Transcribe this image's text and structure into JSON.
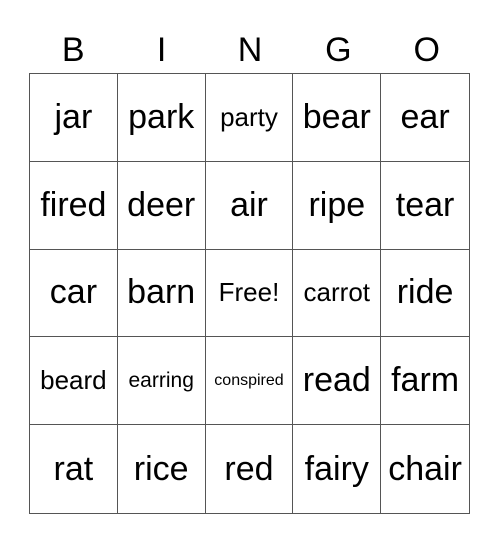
{
  "header": [
    "B",
    "I",
    "N",
    "G",
    "O"
  ],
  "rows": [
    [
      {
        "t": "jar"
      },
      {
        "t": "park"
      },
      {
        "t": "party",
        "s": "s-md"
      },
      {
        "t": "bear"
      },
      {
        "t": "ear"
      }
    ],
    [
      {
        "t": "fired"
      },
      {
        "t": "deer"
      },
      {
        "t": "air"
      },
      {
        "t": "ripe"
      },
      {
        "t": "tear"
      }
    ],
    [
      {
        "t": "car"
      },
      {
        "t": "barn"
      },
      {
        "t": "Free!",
        "s": "s-md"
      },
      {
        "t": "carrot",
        "s": "s-md"
      },
      {
        "t": "ride"
      }
    ],
    [
      {
        "t": "beard",
        "s": "s-md"
      },
      {
        "t": "earring",
        "s": "s-sm"
      },
      {
        "t": "conspired",
        "s": "s-xs"
      },
      {
        "t": "read"
      },
      {
        "t": "farm"
      }
    ],
    [
      {
        "t": "rat"
      },
      {
        "t": "rice"
      },
      {
        "t": "red"
      },
      {
        "t": "fairy"
      },
      {
        "t": "chair"
      }
    ]
  ]
}
